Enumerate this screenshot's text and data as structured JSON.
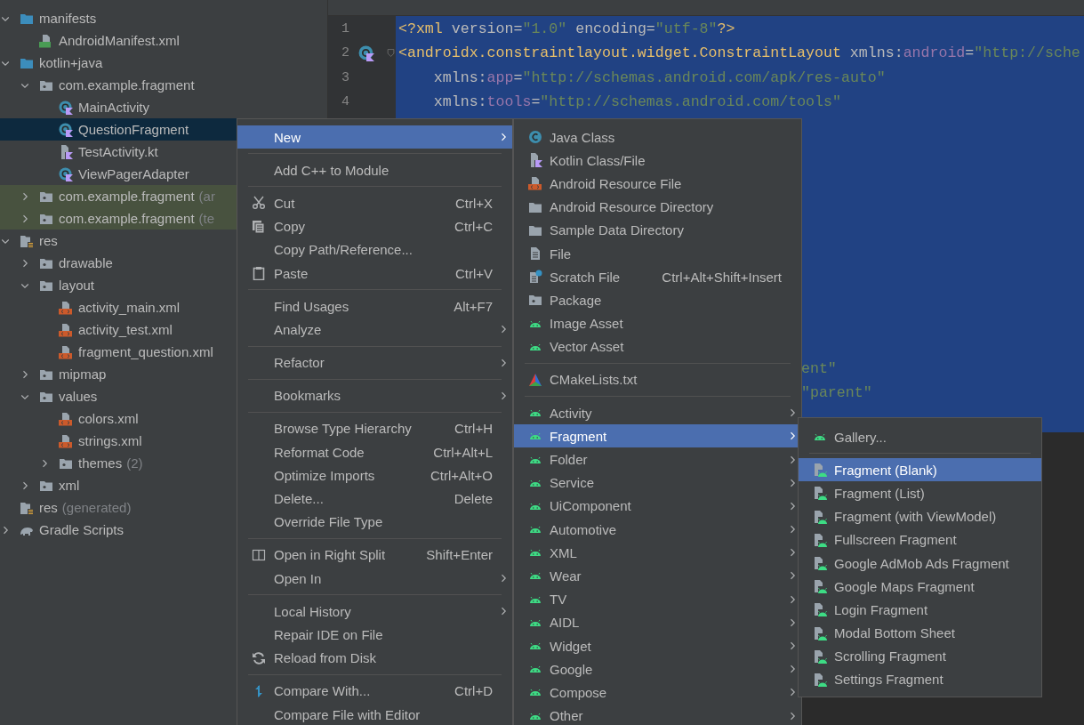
{
  "tree": [
    {
      "children": [
        {
          "label": "manifests",
          "kind": "module-folder",
          "expanded": true,
          "selected": false,
          "highlighted": false,
          "children": [
            {
              "label": "AndroidManifest.xml",
              "kind": "manifest",
              "selected": false,
              "highlighted": false
            }
          ]
        },
        {
          "label": "kotlin+java",
          "kind": "module-folder",
          "expanded": true,
          "selected": false,
          "highlighted": false,
          "children": [
            {
              "label": "com.example.fragment",
              "kind": "package",
              "expanded": true,
              "selected": false,
              "highlighted": false,
              "children": [
                {
                  "label": "MainActivity",
                  "kind": "kotlin-class",
                  "selected": false,
                  "highlighted": false
                },
                {
                  "label": "QuestionFragment",
                  "kind": "kotlin-class",
                  "selected": true,
                  "highlighted": false
                },
                {
                  "label": "TestActivity.kt",
                  "kind": "kotlin-file",
                  "selected": false,
                  "highlighted": false
                },
                {
                  "label": "ViewPagerAdapter",
                  "kind": "kotlin-class",
                  "selected": false,
                  "highlighted": false
                }
              ]
            },
            {
              "label": "com.example.fragment",
              "suffix": "(ar",
              "kind": "package",
              "expanded": false,
              "selected": false,
              "highlighted": true
            },
            {
              "label": "com.example.fragment",
              "suffix": "(te",
              "kind": "package",
              "expanded": false,
              "selected": false,
              "highlighted": true
            }
          ]
        },
        {
          "label": "res",
          "kind": "res-folder",
          "expanded": true,
          "selected": false,
          "highlighted": false,
          "children": [
            {
              "label": "drawable",
              "kind": "package",
              "expanded": false,
              "selected": false,
              "highlighted": false
            },
            {
              "label": "layout",
              "kind": "package",
              "expanded": true,
              "selected": false,
              "highlighted": false,
              "children": [
                {
                  "label": "activity_main.xml",
                  "kind": "xml",
                  "selected": false,
                  "highlighted": false
                },
                {
                  "label": "activity_test.xml",
                  "kind": "xml",
                  "selected": false,
                  "highlighted": false
                },
                {
                  "label": "fragment_question.xml",
                  "kind": "xml",
                  "selected": false,
                  "highlighted": false
                }
              ]
            },
            {
              "label": "mipmap",
              "kind": "package",
              "expanded": false,
              "selected": false,
              "highlighted": false
            },
            {
              "label": "values",
              "kind": "package",
              "expanded": true,
              "selected": false,
              "highlighted": false,
              "children": [
                {
                  "label": "colors.xml",
                  "kind": "xml",
                  "selected": false,
                  "highlighted": false
                },
                {
                  "label": "strings.xml",
                  "kind": "xml",
                  "selected": false,
                  "highlighted": false
                },
                {
                  "label": "themes",
                  "suffix": "(2)",
                  "kind": "package",
                  "expanded": false,
                  "selected": false,
                  "highlighted": false
                }
              ]
            },
            {
              "label": "xml",
              "kind": "package",
              "expanded": false,
              "selected": false,
              "highlighted": false
            }
          ]
        },
        {
          "label": "res",
          "suffix": "(generated)",
          "kind": "res-folder",
          "selected": false,
          "highlighted": false
        }
      ]
    },
    {
      "label": "Gradle Scripts",
      "kind": "gradle",
      "expanded": false,
      "selected": false,
      "highlighted": false
    }
  ],
  "editor": {
    "lines": [
      {
        "number": "1",
        "kind": "plain",
        "fold": false,
        "tokens": [
          {
            "kind": "tag",
            "text": "<?xml"
          },
          {
            "kind": "attr",
            "text": " version="
          },
          {
            "kind": "value",
            "text": "\"1.0\""
          },
          {
            "kind": "attr",
            "text": " encoding="
          },
          {
            "kind": "value",
            "text": "\"utf-8\""
          },
          {
            "kind": "tag",
            "text": "?>"
          }
        ]
      },
      {
        "number": "2",
        "kind": "class",
        "fold": true,
        "tokens": [
          {
            "kind": "tag",
            "text": "<androidx.constraintlayout.widget.ConstraintLayout"
          },
          {
            "kind": "attr",
            "text": " xmlns:"
          },
          {
            "kind": "ns",
            "text": "android"
          },
          {
            "kind": "attr",
            "text": "="
          },
          {
            "kind": "value",
            "text": "\"http://sche"
          }
        ]
      },
      {
        "number": "3",
        "kind": "plain",
        "fold": false,
        "tokens": [
          {
            "kind": "attr",
            "text": "    xmlns:"
          },
          {
            "kind": "ns",
            "text": "app"
          },
          {
            "kind": "attr",
            "text": "="
          },
          {
            "kind": "value",
            "text": "\"http://schemas.android.com/apk/res-auto\""
          }
        ]
      },
      {
        "number": "4",
        "kind": "plain",
        "fold": false,
        "tokens": [
          {
            "kind": "attr",
            "text": "    xmlns:"
          },
          {
            "kind": "ns",
            "text": "tools"
          },
          {
            "kind": "attr",
            "text": "="
          },
          {
            "kind": "value",
            "text": "\"http://schemas.android.com/tools\""
          }
        ]
      }
    ],
    "fragments": [
      {
        "tokens": [
          {
            "kind": "value",
            "text": "ent\""
          }
        ]
      },
      {
        "tokens": [
          {
            "kind": "value",
            "text": "\"parent\""
          }
        ]
      }
    ]
  },
  "context_menus": [
    {
      "items": [
        {
          "kind": "plain",
          "label": "New",
          "submenu": true,
          "selected": true
        },
        {
          "kind": "separator"
        },
        {
          "kind": "plain",
          "label": "Add C++ to Module",
          "submenu": false,
          "selected": false
        },
        {
          "kind": "separator"
        },
        {
          "kind": "scissors",
          "label": "Cut",
          "shortcut": "Ctrl+X",
          "submenu": false,
          "selected": false
        },
        {
          "kind": "copy",
          "label": "Copy",
          "shortcut": "Ctrl+C",
          "submenu": false,
          "selected": false
        },
        {
          "kind": "plain",
          "label": "Copy Path/Reference...",
          "submenu": false,
          "selected": false
        },
        {
          "kind": "clipboard",
          "label": "Paste",
          "shortcut": "Ctrl+V",
          "submenu": false,
          "selected": false
        },
        {
          "kind": "separator"
        },
        {
          "kind": "plain",
          "label": "Find Usages",
          "shortcut": "Alt+F7",
          "submenu": false,
          "selected": false
        },
        {
          "kind": "plain",
          "label": "Analyze",
          "submenu": true,
          "selected": false
        },
        {
          "kind": "separator"
        },
        {
          "kind": "plain",
          "label": "Refactor",
          "submenu": true,
          "selected": false
        },
        {
          "kind": "separator"
        },
        {
          "kind": "plain",
          "label": "Bookmarks",
          "submenu": true,
          "selected": false
        },
        {
          "kind": "separator"
        },
        {
          "kind": "plain",
          "label": "Browse Type Hierarchy",
          "shortcut": "Ctrl+H",
          "submenu": false,
          "selected": false
        },
        {
          "kind": "plain",
          "label": "Reformat Code",
          "shortcut": "Ctrl+Alt+L",
          "submenu": false,
          "selected": false
        },
        {
          "kind": "plain",
          "label": "Optimize Imports",
          "shortcut": "Ctrl+Alt+O",
          "submenu": false,
          "selected": false
        },
        {
          "kind": "plain",
          "label": "Delete...",
          "shortcut": "Delete",
          "submenu": false,
          "selected": false
        },
        {
          "kind": "plain",
          "label": "Override File Type",
          "submenu": false,
          "selected": false
        },
        {
          "kind": "separator"
        },
        {
          "kind": "split",
          "label": "Open in Right Split",
          "shortcut": "Shift+Enter",
          "submenu": false,
          "selected": false
        },
        {
          "kind": "plain",
          "label": "Open In",
          "submenu": true,
          "selected": false
        },
        {
          "kind": "separator"
        },
        {
          "kind": "plain",
          "label": "Local History",
          "submenu": true,
          "selected": false
        },
        {
          "kind": "plain",
          "label": "Repair IDE on File",
          "submenu": false,
          "selected": false
        },
        {
          "kind": "reload",
          "label": "Reload from Disk",
          "submenu": false,
          "selected": false
        },
        {
          "kind": "separator"
        },
        {
          "kind": "compare",
          "label": "Compare With...",
          "shortcut": "Ctrl+D",
          "submenu": false,
          "selected": false
        },
        {
          "kind": "plain",
          "label": "Compare File with Editor",
          "submenu": false,
          "selected": false
        }
      ]
    },
    {
      "items": [
        {
          "kind": "java-class",
          "label": "Java Class",
          "submenu": false,
          "selected": false
        },
        {
          "kind": "kotlin-file",
          "label": "Kotlin Class/File",
          "submenu": false,
          "selected": false
        },
        {
          "kind": "xml",
          "label": "Android Resource File",
          "submenu": false,
          "selected": false
        },
        {
          "kind": "folder",
          "label": "Android Resource Directory",
          "submenu": false,
          "selected": false
        },
        {
          "kind": "folder",
          "label": "Sample Data Directory",
          "submenu": false,
          "selected": false
        },
        {
          "kind": "file",
          "label": "File",
          "submenu": false,
          "selected": false
        },
        {
          "kind": "scratch",
          "label": "Scratch File",
          "shortcut": "Ctrl+Alt+Shift+Insert",
          "submenu": false,
          "selected": false
        },
        {
          "kind": "package",
          "label": "Package",
          "submenu": false,
          "selected": false
        },
        {
          "kind": "android",
          "label": "Image Asset",
          "submenu": false,
          "selected": false
        },
        {
          "kind": "android",
          "label": "Vector Asset",
          "submenu": false,
          "selected": false
        },
        {
          "kind": "separator"
        },
        {
          "kind": "cmake",
          "label": "CMakeLists.txt",
          "submenu": false,
          "selected": false
        },
        {
          "kind": "separator"
        },
        {
          "kind": "android",
          "label": "Activity",
          "submenu": true,
          "selected": false
        },
        {
          "kind": "android",
          "label": "Fragment",
          "submenu": true,
          "selected": true
        },
        {
          "kind": "android",
          "label": "Folder",
          "submenu": true,
          "selected": false
        },
        {
          "kind": "android",
          "label": "Service",
          "submenu": true,
          "selected": false
        },
        {
          "kind": "android",
          "label": "UiComponent",
          "submenu": true,
          "selected": false
        },
        {
          "kind": "android",
          "label": "Automotive",
          "submenu": true,
          "selected": false
        },
        {
          "kind": "android",
          "label": "XML",
          "submenu": true,
          "selected": false
        },
        {
          "kind": "android",
          "label": "Wear",
          "submenu": true,
          "selected": false
        },
        {
          "kind": "android",
          "label": "TV",
          "submenu": true,
          "selected": false
        },
        {
          "kind": "android",
          "label": "AIDL",
          "submenu": true,
          "selected": false
        },
        {
          "kind": "android",
          "label": "Widget",
          "submenu": true,
          "selected": false
        },
        {
          "kind": "android",
          "label": "Google",
          "submenu": true,
          "selected": false
        },
        {
          "kind": "android",
          "label": "Compose",
          "submenu": true,
          "selected": false
        },
        {
          "kind": "android",
          "label": "Other",
          "submenu": true,
          "selected": false
        }
      ]
    },
    {
      "items": [
        {
          "kind": "android",
          "label": "Gallery...",
          "submenu": false,
          "selected": false
        },
        {
          "kind": "separator"
        },
        {
          "kind": "template",
          "label": "Fragment (Blank)",
          "submenu": false,
          "selected": true
        },
        {
          "kind": "template",
          "label": "Fragment (List)",
          "submenu": false,
          "selected": false
        },
        {
          "kind": "template",
          "label": "Fragment (with ViewModel)",
          "submenu": false,
          "selected": false
        },
        {
          "kind": "template",
          "label": "Fullscreen Fragment",
          "submenu": false,
          "selected": false
        },
        {
          "kind": "template",
          "label": "Google AdMob Ads Fragment",
          "submenu": false,
          "selected": false
        },
        {
          "kind": "template",
          "label": "Google Maps Fragment",
          "submenu": false,
          "selected": false
        },
        {
          "kind": "template",
          "label": "Login Fragment",
          "submenu": false,
          "selected": false
        },
        {
          "kind": "template",
          "label": "Modal Bottom Sheet",
          "submenu": false,
          "selected": false
        },
        {
          "kind": "template",
          "label": "Scrolling Fragment",
          "submenu": false,
          "selected": false
        },
        {
          "kind": "template",
          "label": "Settings Fragment",
          "submenu": false,
          "selected": false
        }
      ]
    }
  ]
}
